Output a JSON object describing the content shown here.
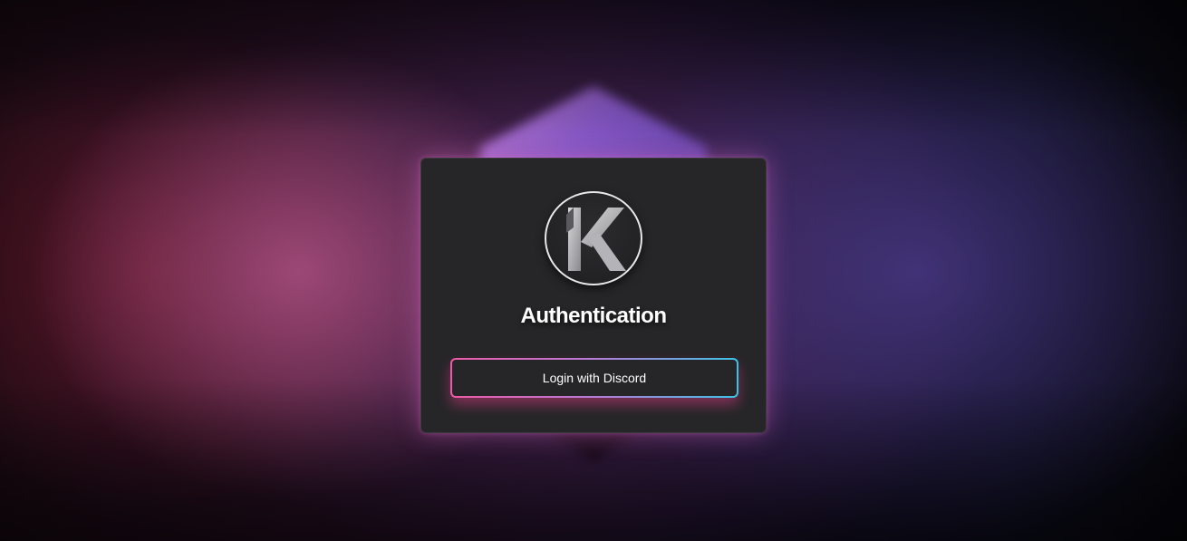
{
  "auth": {
    "title": "Authentication",
    "login_label": "Login with Discord"
  },
  "logo": {
    "icon": "k-letter-logo-icon"
  },
  "colors": {
    "card_background": "#262628",
    "button_gradient_start": "#ef5aa8",
    "button_gradient_end": "#3cc3e8",
    "card_glow": "#dc6ec8"
  }
}
